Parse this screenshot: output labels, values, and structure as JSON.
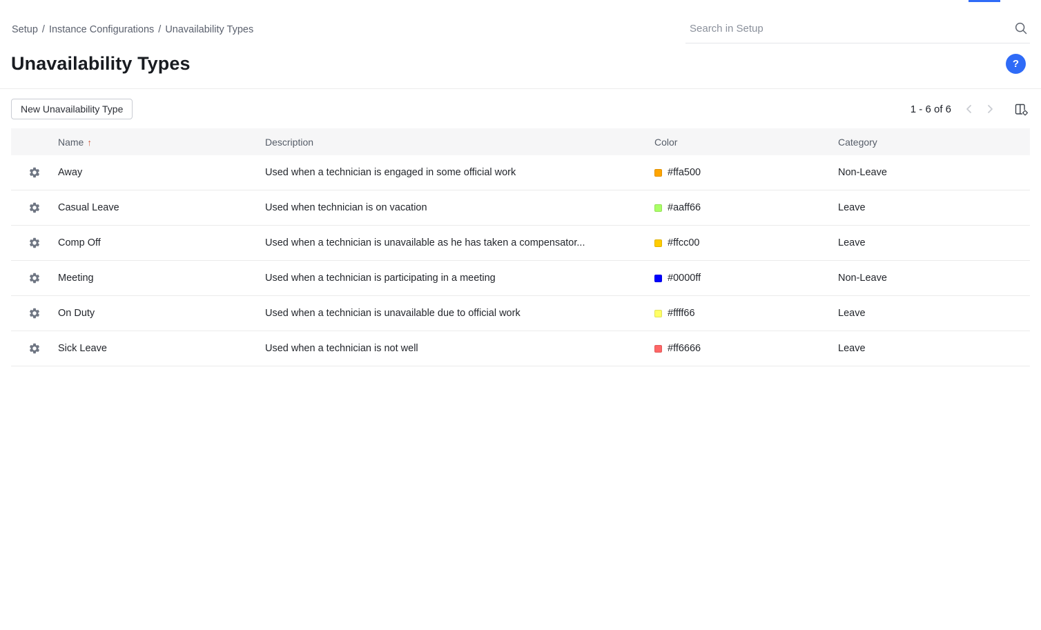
{
  "colors": {
    "accent_blue": "#2f6bf7",
    "sort_arrow": "#cf5a3d"
  },
  "breadcrumb": {
    "items": [
      "Setup",
      "Instance Configurations",
      "Unavailability Types"
    ],
    "separator": "/"
  },
  "search": {
    "placeholder": "Search in Setup"
  },
  "page": {
    "title": "Unavailability Types",
    "help_label": "?"
  },
  "toolbar": {
    "new_button_label": "New Unavailability Type",
    "pagination": "1 - 6 of 6"
  },
  "table": {
    "headers": {
      "name": "Name",
      "description": "Description",
      "color": "Color",
      "category": "Category"
    },
    "sort_indicator": "↑",
    "rows": [
      {
        "name": "Away",
        "description": "Used when a technician is engaged in some official work",
        "color": "#ffa500",
        "category": "Non-Leave"
      },
      {
        "name": "Casual Leave",
        "description": "Used when technician is on vacation",
        "color": "#aaff66",
        "category": "Leave"
      },
      {
        "name": "Comp Off",
        "description": "Used when a technician is unavailable as he has taken a compensator...",
        "color": "#ffcc00",
        "category": "Leave"
      },
      {
        "name": "Meeting",
        "description": "Used when a technician is participating in a meeting",
        "color": "#0000ff",
        "category": "Non-Leave"
      },
      {
        "name": "On Duty",
        "description": "Used when a technician is unavailable due to official work",
        "color": "#ffff66",
        "category": "Leave"
      },
      {
        "name": "Sick Leave",
        "description": "Used when a technician is not well",
        "color": "#ff6666",
        "category": "Leave"
      }
    ]
  }
}
